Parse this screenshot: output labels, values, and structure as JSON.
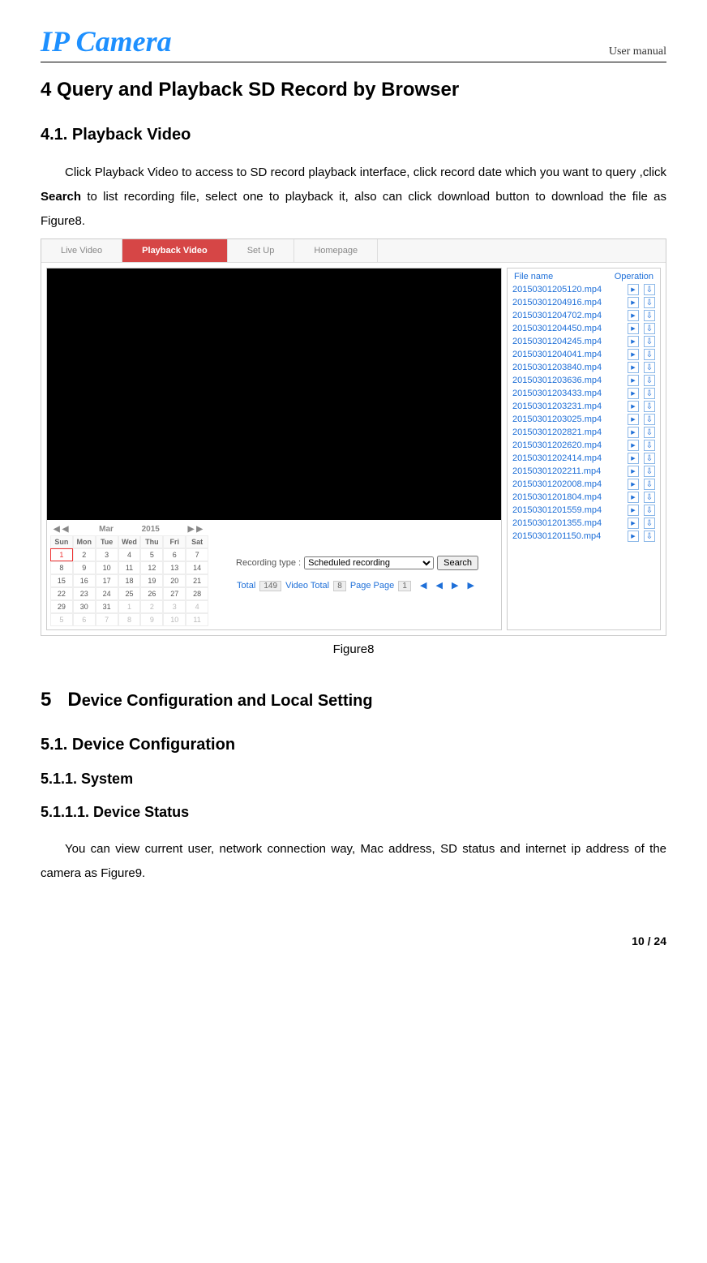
{
  "header": {
    "logo": "IP Camera",
    "right": "User manual"
  },
  "section4": {
    "title": "4   Query and Playback SD Record by Browser",
    "sub41_title": "4.1. Playback Video",
    "para": "Click Playback Video to access to SD record playback interface, click record date which you want to query ,click Search to list recording file, select one to playback it, also can click download button to download the file as Figure8.",
    "figure_caption": "Figure8"
  },
  "fig8": {
    "tabs": [
      "Live Video",
      "Playback Video",
      "Set Up",
      "Homepage"
    ],
    "active_tab_index": 1,
    "calendar": {
      "month": "Mar",
      "year": "2015",
      "dow": [
        "Sun",
        "Mon",
        "Tue",
        "Wed",
        "Thu",
        "Fri",
        "Sat"
      ],
      "days_row1": [
        "1",
        "2",
        "3",
        "4",
        "5",
        "6",
        "7"
      ],
      "days_row2": [
        "8",
        "9",
        "10",
        "11",
        "12",
        "13",
        "14"
      ],
      "days_row3": [
        "15",
        "16",
        "17",
        "18",
        "19",
        "20",
        "21"
      ],
      "days_row4": [
        "22",
        "23",
        "24",
        "25",
        "26",
        "27",
        "28"
      ],
      "days_row5": [
        "29",
        "30",
        "31",
        "1",
        "2",
        "3",
        "4"
      ],
      "days_row6": [
        "5",
        "6",
        "7",
        "8",
        "9",
        "10",
        "11"
      ],
      "selected_day": "1"
    },
    "recording_type_label": "Recording type :",
    "recording_type_value": "Scheduled recording",
    "search_label": "Search",
    "pager": {
      "total_label": "Total",
      "total_value": "149",
      "video_total_label": "Video Total",
      "video_total_value": "8",
      "page_label": "Page Page",
      "page_value": "1"
    },
    "file_header": {
      "name": "File name",
      "op": "Operation"
    },
    "files": [
      "20150301205120.mp4",
      "20150301204916.mp4",
      "20150301204702.mp4",
      "20150301204450.mp4",
      "20150301204245.mp4",
      "20150301204041.mp4",
      "20150301203840.mp4",
      "20150301203636.mp4",
      "20150301203433.mp4",
      "20150301203231.mp4",
      "20150301203025.mp4",
      "20150301202821.mp4",
      "20150301202620.mp4",
      "20150301202414.mp4",
      "20150301202211.mp4",
      "20150301202008.mp4",
      "20150301201804.mp4",
      "20150301201559.mp4",
      "20150301201355.mp4",
      "20150301201150.mp4"
    ]
  },
  "section5": {
    "title": "5   Device Configuration and Local Setting",
    "sub51_title": "5.1. Device Configuration",
    "sub511_title": "5.1.1.  System",
    "sub5111_title": "5.1.1.1. Device Status",
    "para": "You can view current user, network connection way, Mac address, SD status and internet ip address of the camera as Figure9."
  },
  "page_no": "10 / 24"
}
